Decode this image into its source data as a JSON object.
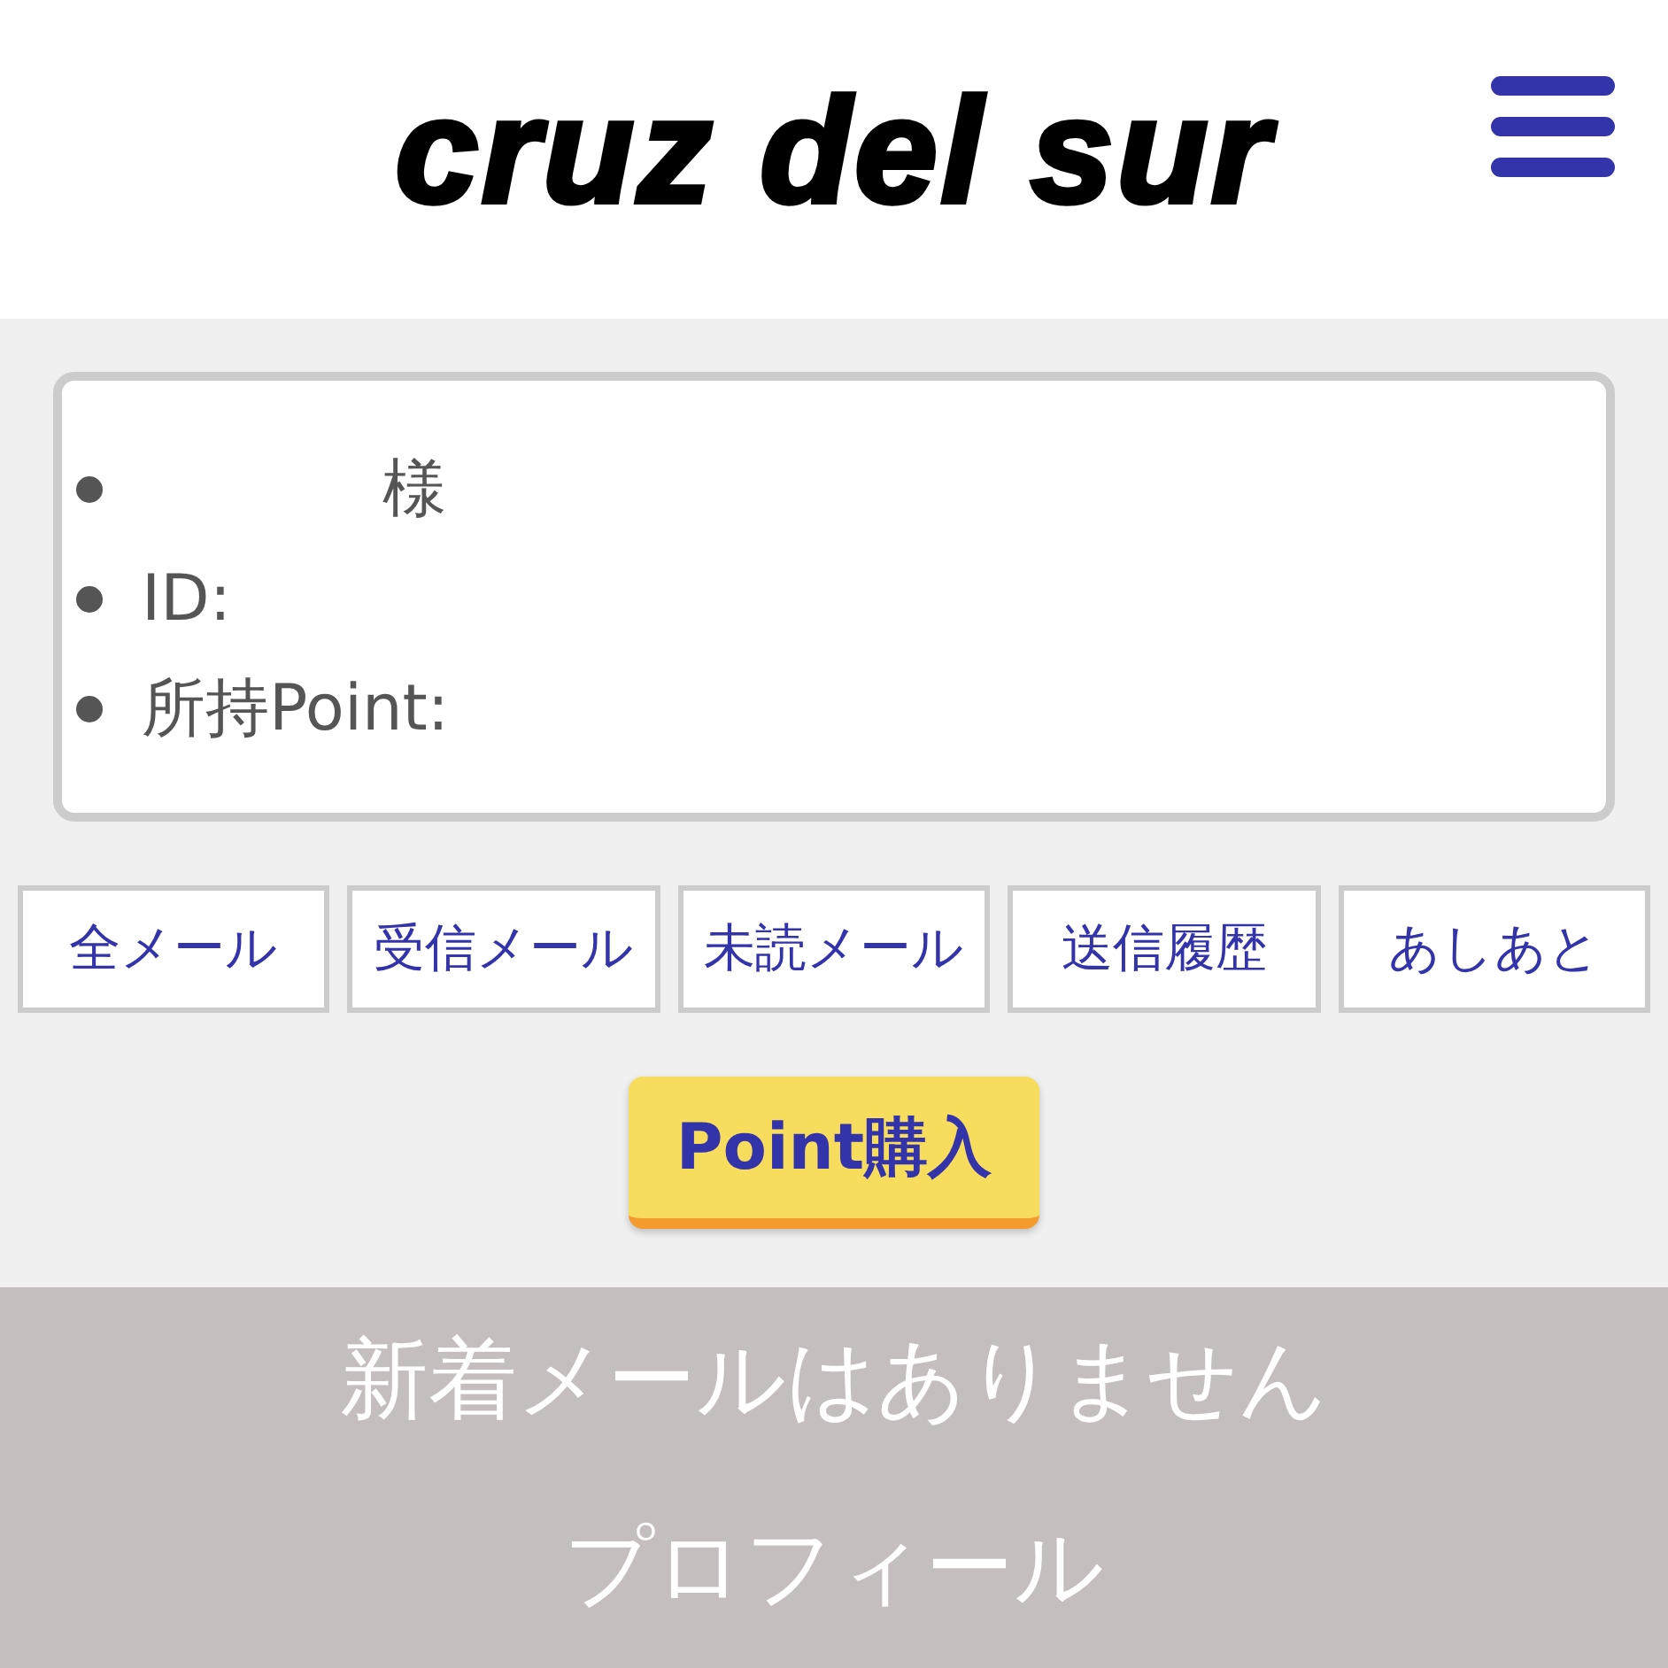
{
  "header": {
    "logo": "cruz del sur"
  },
  "account": {
    "items": [
      {
        "kind": "name",
        "text": "様"
      },
      {
        "kind": "plain",
        "text": "ID:"
      },
      {
        "kind": "plain",
        "text": "所持Point:"
      }
    ]
  },
  "mail_tabs": [
    "全メール",
    "受信メール",
    "未読メール",
    "送信履歴",
    "あしあと"
  ],
  "buy_button": "Point購入",
  "notice": "新着メールはありません",
  "menu_links": [
    "プロフィール"
  ]
}
